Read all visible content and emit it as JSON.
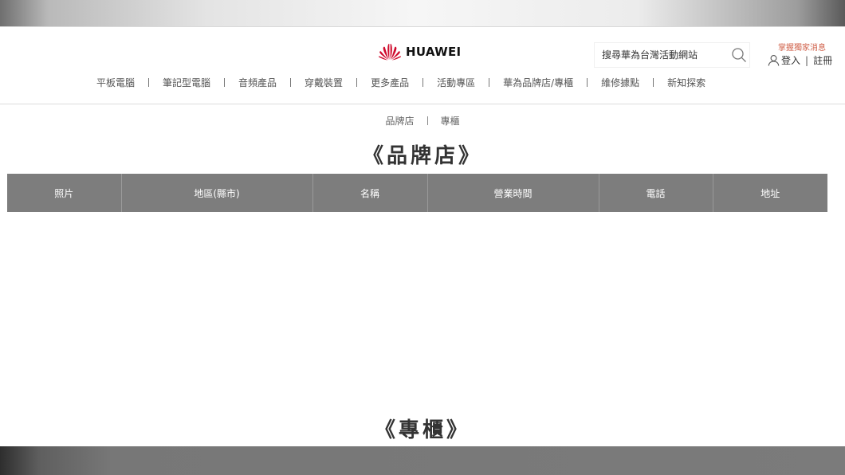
{
  "header": {
    "logo_text": "HUAWEI",
    "search": {
      "placeholder": "搜尋華為台灣活動網站"
    },
    "promo_text": "掌握獨家消息",
    "login_label": "登入",
    "register_label": "註冊",
    "nav": [
      "平板電腦",
      "筆記型電腦",
      "音頻產品",
      "穿戴裝置",
      "更多產品",
      "活動專區",
      "華為品牌店/專櫃",
      "維修據點",
      "新知探索"
    ]
  },
  "sub_nav": {
    "brand_store": "品牌店",
    "counter": "專櫃"
  },
  "brand_section": {
    "title": "《品牌店》",
    "table_headers": [
      "照片",
      "地區(縣市)",
      "名稱",
      "營業時間",
      "電話",
      "地址"
    ]
  },
  "counter_section": {
    "title": "《專櫃》"
  },
  "colors": {
    "brand_red": "#cf0a2c",
    "table_header_bg": "#7d7d7d",
    "promo": "#d0614a"
  }
}
